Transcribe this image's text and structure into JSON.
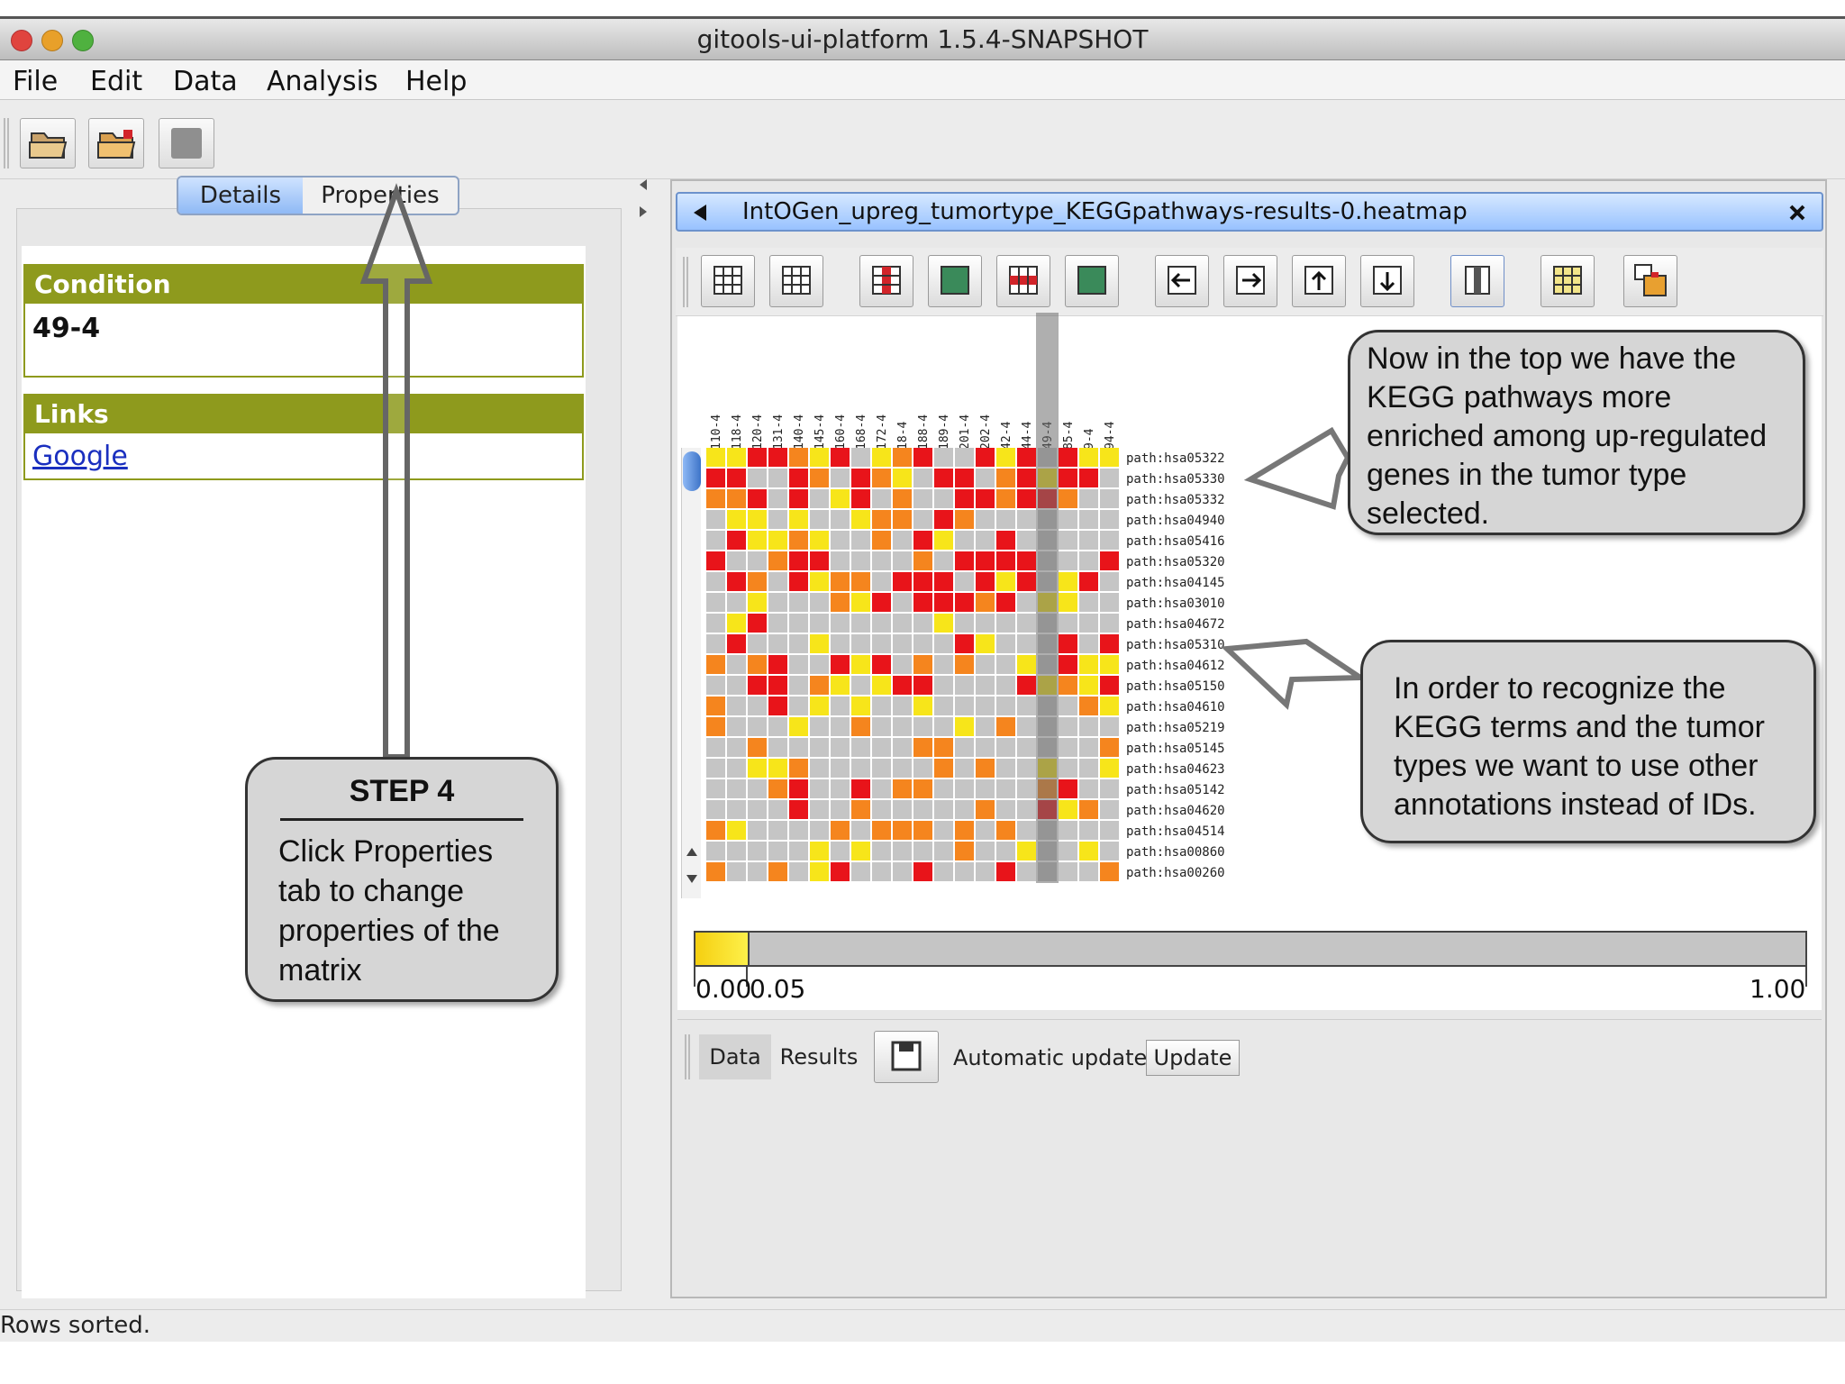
{
  "window": {
    "title": "gitools-ui-platform 1.5.4-SNAPSHOT"
  },
  "menu": [
    "File",
    "Edit",
    "Data",
    "Analysis",
    "Help"
  ],
  "left_panel": {
    "tabs": [
      "Details",
      "Properties"
    ],
    "condition": {
      "header": "Condition",
      "value": "49-4"
    },
    "links": {
      "header": "Links",
      "link": "Google"
    }
  },
  "editor": {
    "file_tab": "IntOGen_upreg_tumortype_KEGGpathways-results-0.heatmap",
    "close_icon": "close-icon"
  },
  "heatmap": {
    "columns": [
      "110-4",
      "118-4",
      "120-4",
      "131-4",
      "140-4",
      "145-4",
      "160-4",
      "168-4",
      "172-4",
      "18-4",
      "188-4",
      "189-4",
      "201-4",
      "202-4",
      "42-4",
      "44-4",
      "49-4",
      "85-4",
      "9-4",
      "94-4"
    ],
    "rows": [
      "path:hsa05322",
      "path:hsa05330",
      "path:hsa05332",
      "path:hsa04940",
      "path:hsa05416",
      "path:hsa05320",
      "path:hsa04145",
      "path:hsa03010",
      "path:hsa04672",
      "path:hsa05310",
      "path:hsa04612",
      "path:hsa05150",
      "path:hsa04610",
      "path:hsa05219",
      "path:hsa05145",
      "path:hsa04623",
      "path:hsa05142",
      "path:hsa04620",
      "path:hsa04514",
      "path:hsa00860",
      "path:hsa00260"
    ],
    "selected_column": "49-4",
    "colors": {
      "red": "#e8141a",
      "orange": "#f5851e",
      "yellow": "#f7e51a",
      "gray": "#c5c5c5"
    }
  },
  "scale": {
    "labels": [
      "0.00",
      "0.05",
      "1.00"
    ]
  },
  "bottom_panel": {
    "tabs": [
      "Data",
      "Results"
    ],
    "save_icon": "save-icon",
    "auto_update": "Automatic update",
    "update_button": "Update"
  },
  "status": "Rows sorted.",
  "callouts": {
    "step_title": "STEP 4",
    "step_text": "Click Properties tab to change properties of the matrix",
    "top_text": "Now in the top we have the KEGG pathways more enriched among up-regulated genes in the tumor type selected.",
    "bottom_text": "In order to recognize the KEGG terms and the tumor types we want to use other annotations instead of IDs."
  }
}
